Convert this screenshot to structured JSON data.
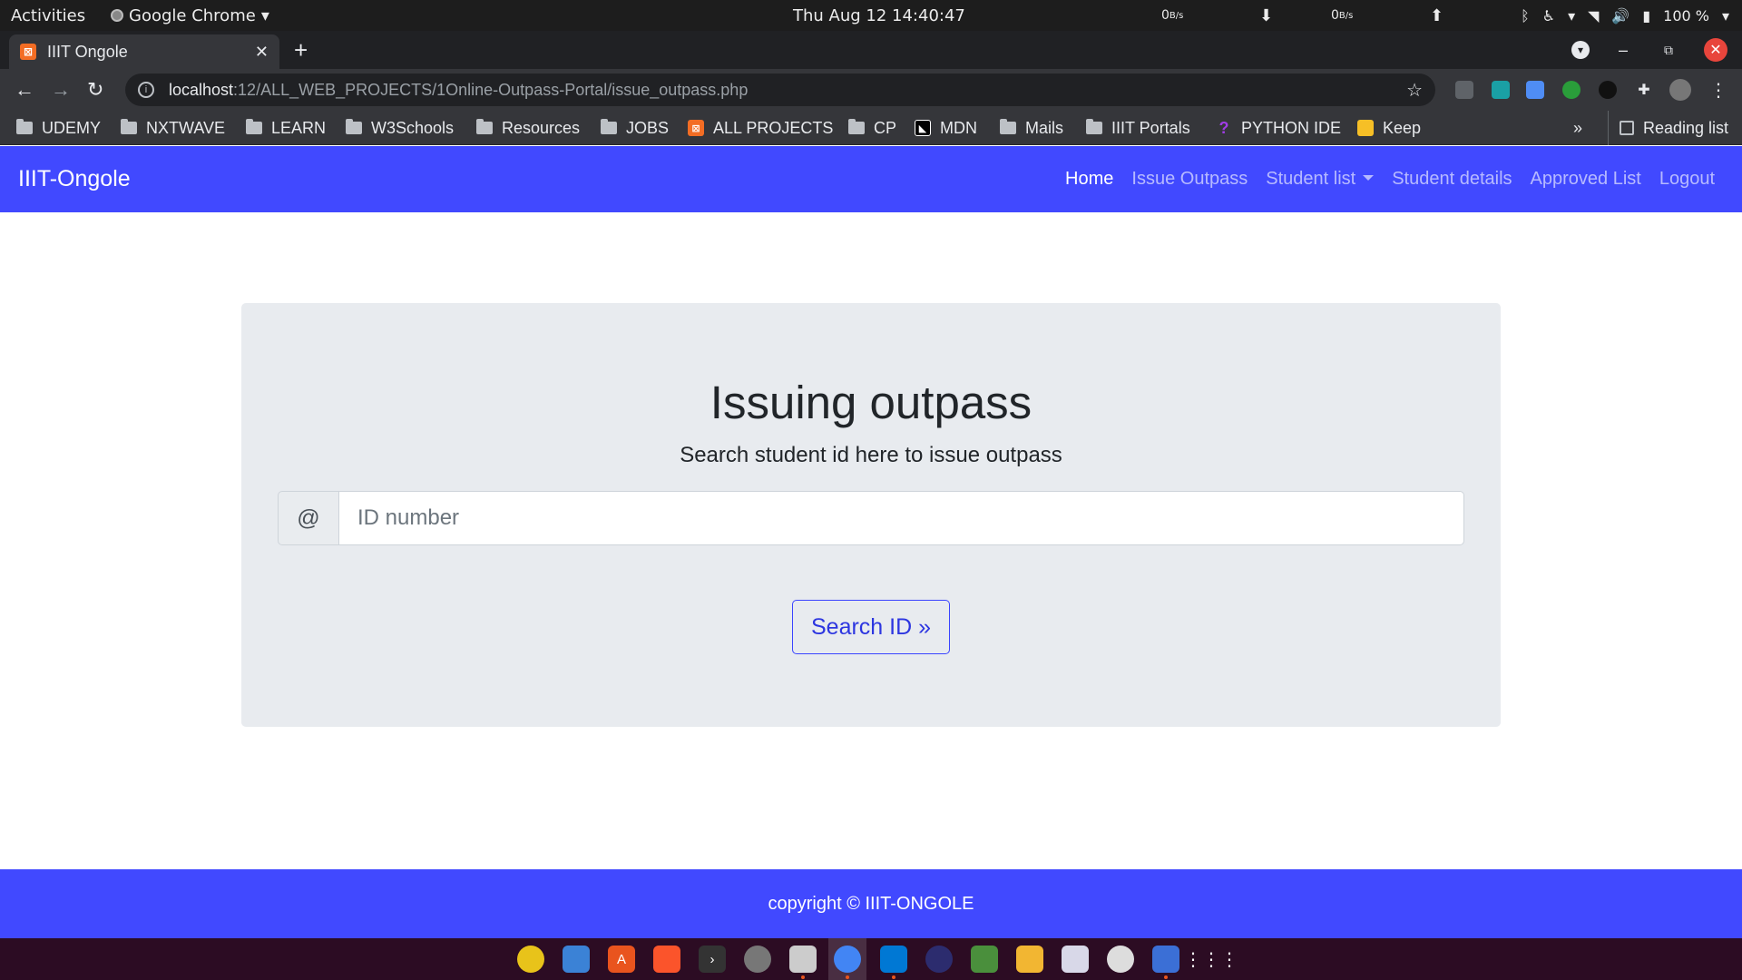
{
  "system_bar": {
    "activities": "Activities",
    "app_name": "Google Chrome",
    "clock": "Thu Aug 12  14:40:47",
    "net_down": "0",
    "net_down_unit": "B/s",
    "net_up": "0",
    "net_up_unit": "B/s",
    "battery": "100 %"
  },
  "browser": {
    "tab_title": "IIIT Ongole",
    "url_host": "localhost",
    "url_path": ":12/ALL_WEB_PROJECTS/1Online-Outpass-Portal/issue_outpass.php",
    "bookmarks": [
      {
        "label": "UDEMY",
        "icon": "folder-icon"
      },
      {
        "label": "NXTWAVE",
        "icon": "folder-icon"
      },
      {
        "label": "LEARN",
        "icon": "folder-icon"
      },
      {
        "label": "W3Schools",
        "icon": "folder-icon"
      },
      {
        "label": "Resources",
        "icon": "folder-icon"
      },
      {
        "label": "JOBS",
        "icon": "folder-icon"
      },
      {
        "label": "ALL PROJECTS",
        "icon": "xampp-icon"
      },
      {
        "label": "CP",
        "icon": "folder-icon"
      },
      {
        "label": "MDN",
        "icon": "mdn-icon"
      },
      {
        "label": "Mails",
        "icon": "folder-icon"
      },
      {
        "label": "IIIT Portals",
        "icon": "folder-icon"
      },
      {
        "label": "PYTHON IDE",
        "icon": "python-ide-icon"
      },
      {
        "label": "Keep",
        "icon": "keep-icon"
      }
    ],
    "bookmarks_more": "»",
    "reading_list": "Reading list"
  },
  "navbar": {
    "brand": "IIIT-Ongole",
    "links": [
      "Home",
      "Issue Outpass",
      "Student list",
      "Student details",
      "Approved List",
      "Logout"
    ]
  },
  "jumbotron": {
    "title": "Issuing outpass",
    "subtitle": "Search student id here to issue outpass",
    "input_prefix": "@",
    "input_placeholder": "ID number",
    "input_value": "",
    "button_label": "Search ID »"
  },
  "footer": {
    "text": "copyright © IIIT-ONGOLE"
  },
  "colors": {
    "brand_blue": "#4149ff",
    "jumbotron_bg": "#e8ebef",
    "button_border": "#3a44ff"
  }
}
